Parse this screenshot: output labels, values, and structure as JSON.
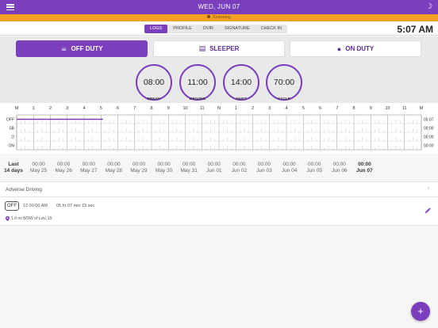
{
  "header": {
    "title": "WED, JUN  07",
    "menu_icon": "hamburger-icon",
    "theme_icon": "moon-icon"
  },
  "scan_banner": {
    "text": "Scanning"
  },
  "tabs": [
    {
      "label": "LOGS",
      "active": true
    },
    {
      "label": "PROFILE",
      "active": false
    },
    {
      "label": "DVIR",
      "active": false
    },
    {
      "label": "SIGNATURE",
      "active": false
    },
    {
      "label": "CHECK IN",
      "active": false
    }
  ],
  "clock": "5:07 AM",
  "status_buttons": [
    {
      "label": "OFF DUTY",
      "icon": "coffee-cup-icon",
      "selected": true
    },
    {
      "label": "SLEEPER",
      "icon": "bed-icon",
      "selected": false
    },
    {
      "label": "ON DUTY",
      "icon": "users-icon",
      "selected": false
    }
  ],
  "gauges": [
    {
      "value": "08:00",
      "label": "BREAK"
    },
    {
      "value": "11:00",
      "label": "DRIVING"
    },
    {
      "value": "14:00",
      "label": "SHIFT"
    },
    {
      "value": "70:00",
      "label": "CYCLE"
    }
  ],
  "log_graph": {
    "hour_labels": [
      "M",
      "1",
      "2",
      "3",
      "4",
      "5",
      "6",
      "7",
      "8",
      "9",
      "10",
      "11",
      "N",
      "1",
      "2",
      "3",
      "4",
      "5",
      "6",
      "7",
      "8",
      "9",
      "10",
      "11",
      "M"
    ],
    "rows": [
      "OFF",
      "SB",
      "D",
      "ON"
    ],
    "totals": [
      "05:07",
      "00:00",
      "00:00",
      "00:00"
    ],
    "off_duty_until_hours": 5.12
  },
  "days": [
    {
      "hours": "Last",
      "date": "14 days"
    },
    {
      "hours": "00:00",
      "date": "May 25"
    },
    {
      "hours": "00:00",
      "date": "May 26"
    },
    {
      "hours": "00:00",
      "date": "May 27"
    },
    {
      "hours": "00:00",
      "date": "May 28"
    },
    {
      "hours": "00:00",
      "date": "May 29"
    },
    {
      "hours": "00:00",
      "date": "May 30"
    },
    {
      "hours": "00:00",
      "date": "May 31"
    },
    {
      "hours": "00:00",
      "date": "Jun 01"
    },
    {
      "hours": "00:00",
      "date": "Jun 02"
    },
    {
      "hours": "00:00",
      "date": "Jun 03"
    },
    {
      "hours": "00:00",
      "date": "Jun 04"
    },
    {
      "hours": "00:00",
      "date": "Jun 05"
    },
    {
      "hours": "00:00",
      "date": "Jun 06"
    },
    {
      "hours": "00:00",
      "date": "Jun 07"
    }
  ],
  "adverse_driving": {
    "label": "Adverse Driving",
    "chevron": "›"
  },
  "log_entry": {
    "status": "OFF",
    "time": "12:00:00 AM",
    "duration": "05 hr 07 min 15 sec",
    "location": "1.9 mi WSW of Lviv, 15"
  },
  "fab": {
    "label": "+"
  },
  "colors": {
    "accent": "#7b3fbe",
    "banner": "#f4a024"
  }
}
